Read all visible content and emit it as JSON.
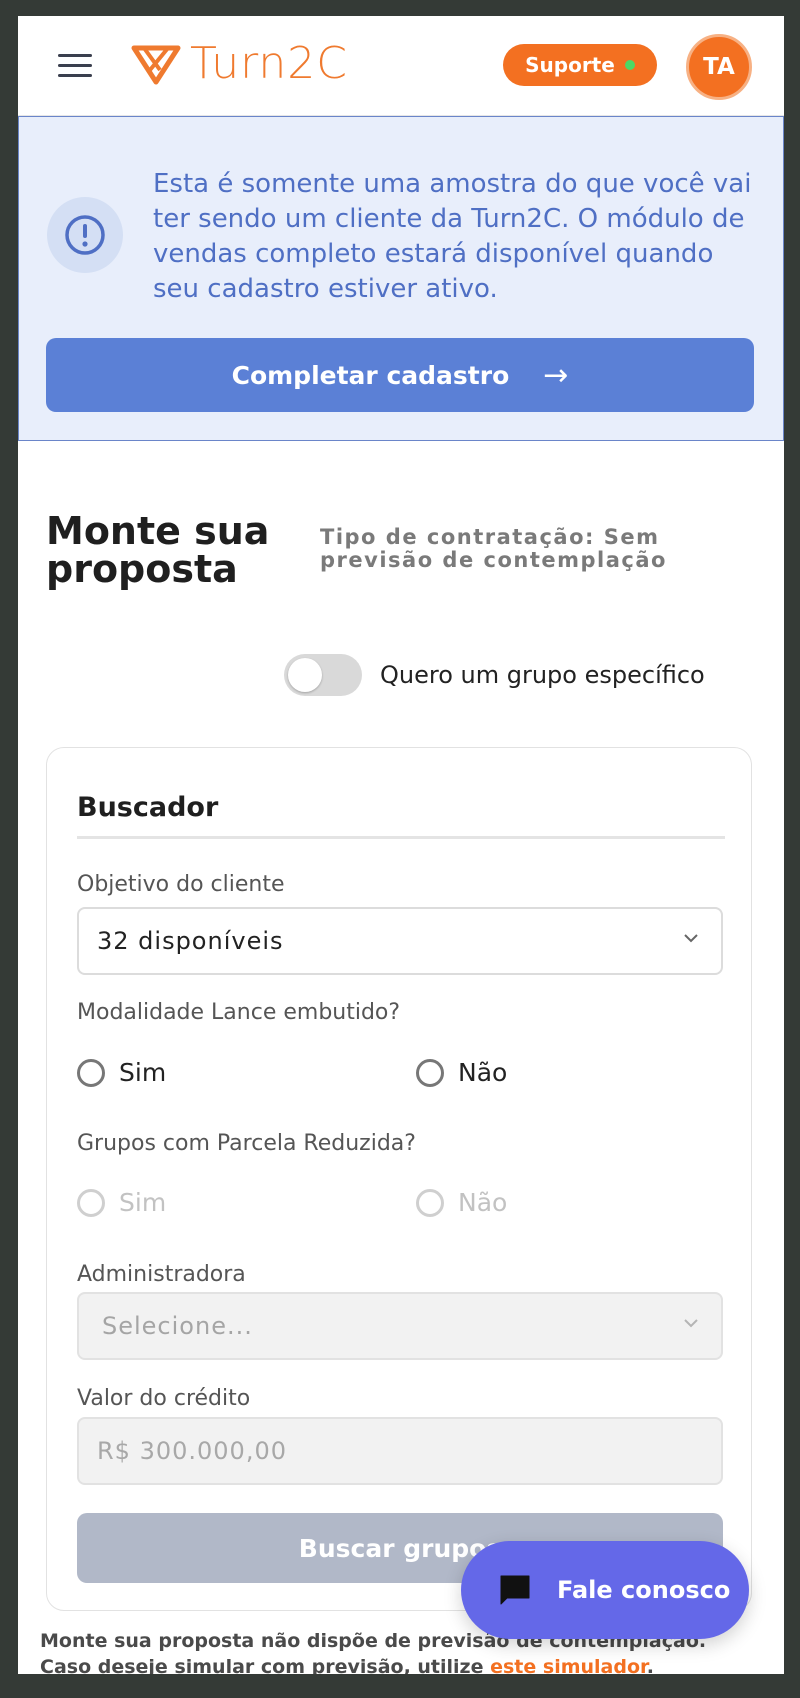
{
  "header": {
    "logo_text": "Turn2C",
    "support_label": "Suporte",
    "avatar_initials": "TA"
  },
  "banner": {
    "message": "Esta é somente uma amostra do que você vai ter sendo um cliente da Turn2C. O módulo de vendas completo estará disponível quando seu cadastro estiver ativo.",
    "button_label": "Completar cadastro",
    "button_arrow": "→"
  },
  "page": {
    "title": "Monte sua proposta",
    "subtitle": "Tipo de contratação: Sem previsão de contemplação",
    "toggle_label": "Quero um grupo específico",
    "toggle_on": false
  },
  "finder": {
    "title": "Buscador",
    "objective_label": "Objetivo do cliente",
    "objective_value": "32 disponíveis",
    "embedded_bid_label": "Modalidade Lance embutido?",
    "embedded_bid_yes": "Sim",
    "embedded_bid_no": "Não",
    "reduced_label": "Grupos com Parcela Reduzida?",
    "reduced_yes": "Sim",
    "reduced_no": "Não",
    "admin_label": "Administradora",
    "admin_placeholder": "Selecione...",
    "credit_label": "Valor do crédito",
    "credit_placeholder": "R$ 300.000,00",
    "search_label": "Buscar grupos"
  },
  "footer": {
    "note_part1": "Monte sua proposta não dispõe de previsão de contemplação. Caso deseje simular com previsão, utilize ",
    "note_link": "este simulador",
    "note_part2": "."
  },
  "chat": {
    "label": "Fale conosco"
  },
  "colors": {
    "brand_orange": "#f37021",
    "banner_blue": "#5b80d6",
    "chat_purple": "#6468e8"
  }
}
